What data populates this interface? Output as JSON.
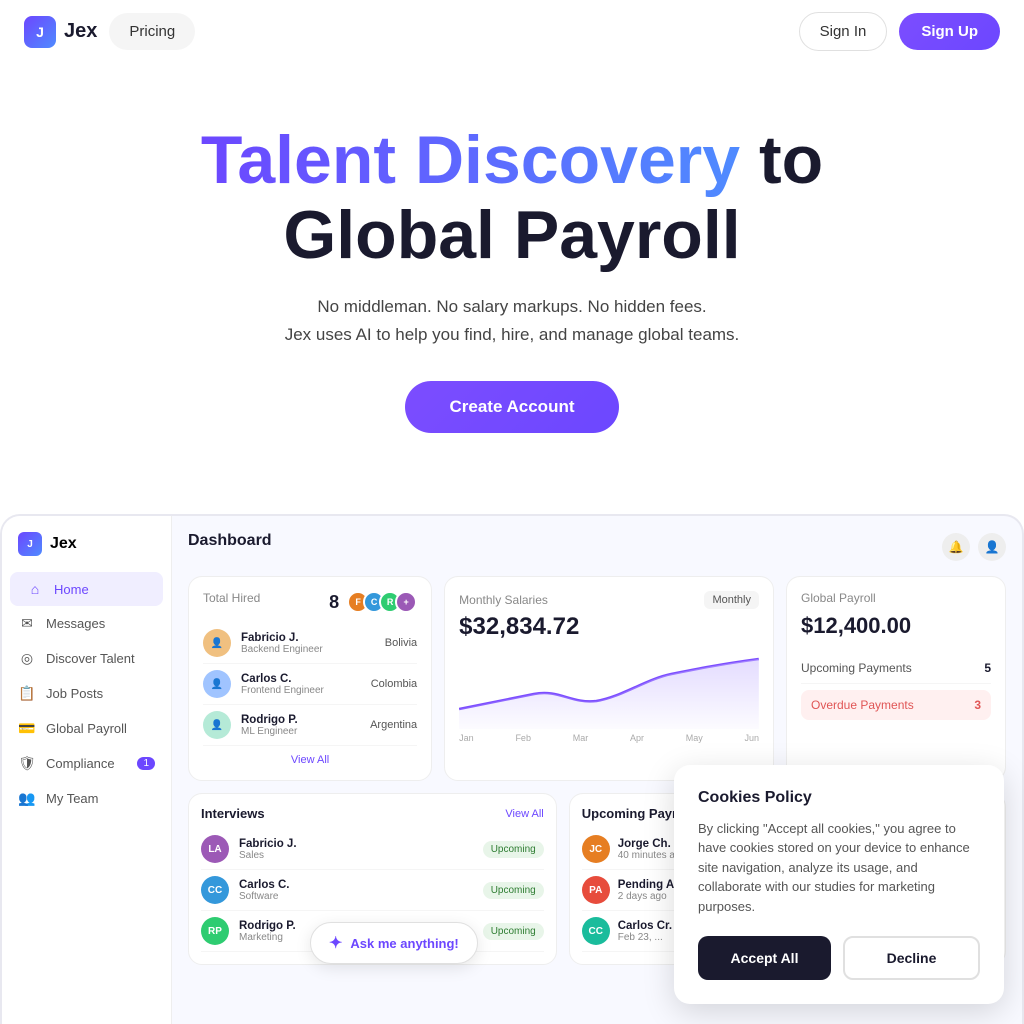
{
  "navbar": {
    "logo_letter": "J",
    "logo_name": "Jex",
    "pricing_label": "Pricing",
    "signin_label": "Sign In",
    "signup_label": "Sign Up"
  },
  "hero": {
    "title_gradient": "Talent Discovery",
    "title_rest": " to\nGlobal Payroll",
    "subtitle1": "No middleman. No salary markups. No hidden fees.",
    "subtitle2": "Jex uses AI to help you find, hire, and manage global teams.",
    "cta_label": "Create Account"
  },
  "dashboard": {
    "header": "Dashboard",
    "total_hired": {
      "label": "Total Hired",
      "count": "8",
      "employees": [
        {
          "name": "Fabricio J.",
          "role": "Backend Engineer",
          "country": "Bolivia"
        },
        {
          "name": "Carlos C.",
          "role": "Frontend Engineer",
          "country": "Colombia"
        },
        {
          "name": "Rodrigo P.",
          "role": "ML Engineer",
          "country": "Argentina"
        }
      ],
      "view_all": "View All"
    },
    "monthly_salaries": {
      "title": "Monthly Salaries",
      "filter": "Monthly",
      "amount": "$32,834.72",
      "chart_labels": [
        "Jan",
        "Feb",
        "Mar",
        "Apr",
        "May",
        "Jun"
      ]
    },
    "global_payroll": {
      "title": "Global Payroll",
      "amount": "$12,400.00",
      "upcoming_label": "Upcoming Payments",
      "upcoming_count": "5",
      "overdue_label": "Overdue Payments",
      "overdue_count": "3"
    },
    "sidebar": {
      "logo": "Jex",
      "items": [
        {
          "label": "Home",
          "icon": "⌂",
          "active": true
        },
        {
          "label": "Messages",
          "icon": "✉",
          "active": false
        },
        {
          "label": "Discover Talent",
          "icon": "◎",
          "active": false
        },
        {
          "label": "Job Posts",
          "icon": "📋",
          "active": false
        },
        {
          "label": "Global Payroll",
          "icon": "💳",
          "active": false
        },
        {
          "label": "Compliance",
          "icon": "🛡",
          "active": false,
          "badge": "1"
        },
        {
          "label": "My Team",
          "icon": "👥",
          "active": false
        }
      ]
    },
    "interviews": {
      "title": "Interviews",
      "view_all": "View All",
      "items": [
        {
          "initials": "LA",
          "name": "Fabricio J.",
          "role": "Sales",
          "status": "Upcoming",
          "color": "#9c59b6"
        },
        {
          "initials": "CC",
          "name": "Carlos C.",
          "role": "Software",
          "status": "Upcoming",
          "color": "#3498db"
        },
        {
          "initials": "RP",
          "name": "Rodrigo P.",
          "role": "Marketing",
          "status": "Upcoming",
          "color": "#2ecc71"
        }
      ]
    },
    "upcoming_payments": {
      "title": "Upcoming Payments",
      "items": [
        {
          "name": "Jorge Ch.",
          "sub": "40 minutes ago"
        },
        {
          "name": "Pending A.",
          "sub": "2 days ago"
        },
        {
          "name": "Carlos Cr.",
          "sub": "Feb 23, ..."
        }
      ]
    },
    "ai_button": "✦ Ask me anything!"
  },
  "cookie": {
    "title": "Cookies Policy",
    "text": "By clicking \"Accept all cookies,\" you agree to have cookies stored on your device to enhance site navigation, analyze its usage, and collaborate with our studies for marketing purposes.",
    "accept_label": "Accept All",
    "decline_label": "Decline"
  }
}
